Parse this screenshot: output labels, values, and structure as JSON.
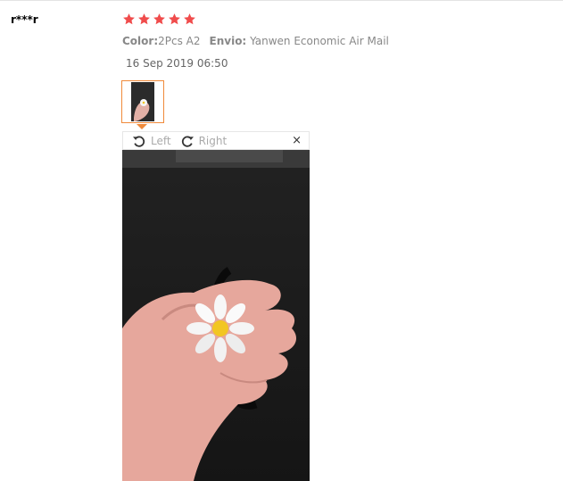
{
  "review": {
    "reviewer": "r***r",
    "rating": 5,
    "color_label": "Color:",
    "color_value": "2Pcs A2",
    "shipping_label": "Envio:",
    "shipping_value": "Yanwen Economic Air Mail",
    "date": "16 Sep 2019 06:50"
  },
  "viewer": {
    "rotate_left_label": "Left",
    "rotate_right_label": "Right",
    "close_label": "×"
  },
  "colors": {
    "star": "#f04c4c",
    "thumb_border": "#f08a3a"
  },
  "icons": [
    "star-icon",
    "rotate-left-icon",
    "rotate-right-icon",
    "close-icon"
  ]
}
